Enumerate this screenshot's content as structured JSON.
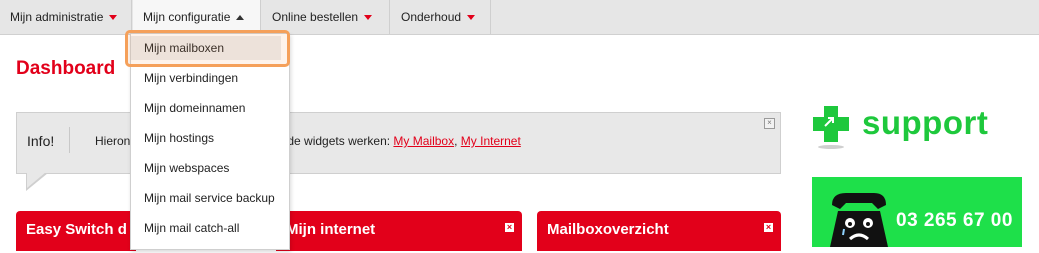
{
  "nav": {
    "items": [
      {
        "label": "Mijn administratie"
      },
      {
        "label": "Mijn configuratie"
      },
      {
        "label": "Online bestellen"
      },
      {
        "label": "Onderhoud"
      }
    ]
  },
  "dropdown": {
    "items": [
      {
        "label": "Mijn mailboxen"
      },
      {
        "label": "Mijn verbindingen"
      },
      {
        "label": "Mijn domeinnamen"
      },
      {
        "label": "Mijn hostings"
      },
      {
        "label": "Mijn webspaces"
      },
      {
        "label": "Mijn mail service backup"
      },
      {
        "label": "Mijn mail catch-all"
      }
    ]
  },
  "page": {
    "title": "Dashboard"
  },
  "info": {
    "label": "Info!",
    "text_prefix": "Hieron",
    "text_middle": "de widgets werken: ",
    "link1": "My Mailbox",
    "separator": ", ",
    "link2": "My Internet",
    "close": "×"
  },
  "widgets": [
    {
      "title": "Easy Switch d"
    },
    {
      "title": "Mijn internet"
    },
    {
      "title": "Mailboxoverzicht"
    }
  ],
  "support": {
    "label": "support",
    "phone": "03  265 67 00"
  },
  "colors": {
    "accent": "#e2001a",
    "support_green": "#1ec83c",
    "phone_bg": "#1ee04a",
    "highlight": "#f5a05a"
  }
}
